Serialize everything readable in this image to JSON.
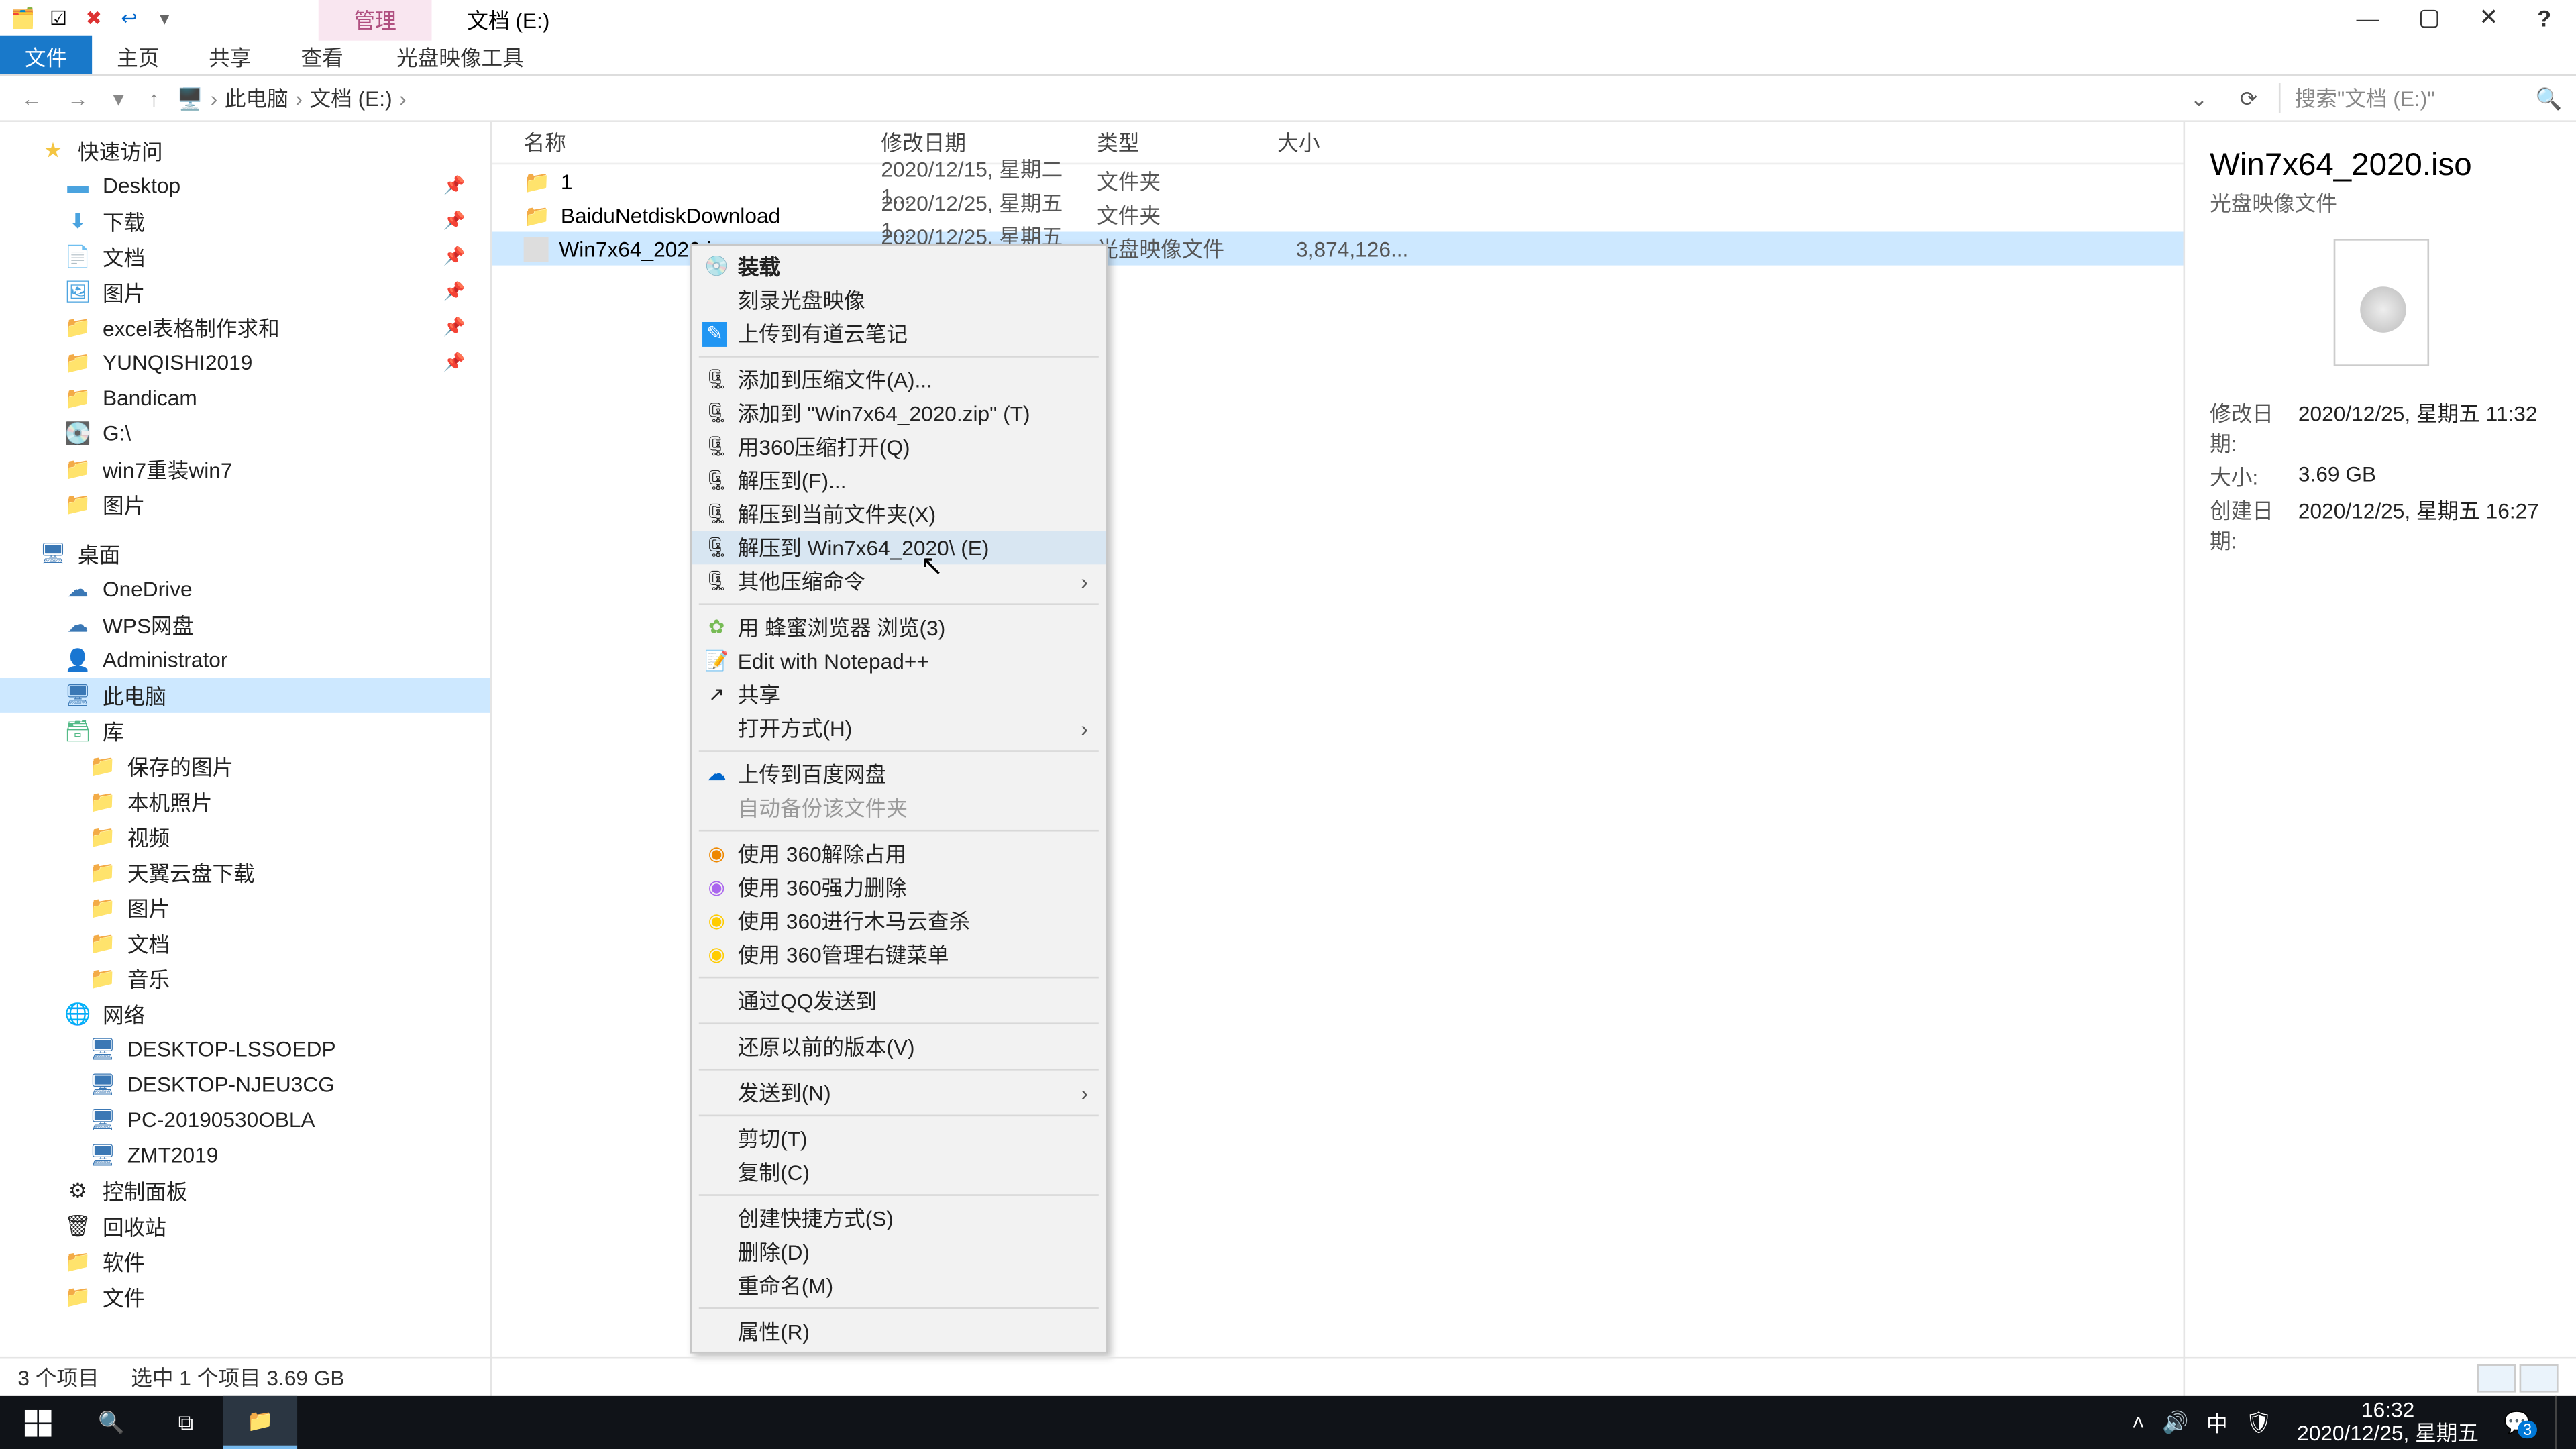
{
  "window": {
    "title_tab_manage": "管理",
    "title_tab_location": "文档 (E:)"
  },
  "ribbon": {
    "file": "文件",
    "home": "主页",
    "share": "共享",
    "view": "查看",
    "iso_tools": "光盘映像工具"
  },
  "address": {
    "root": "此电脑",
    "folder": "文档 (E:)",
    "search_placeholder": "搜索\"文档 (E:)\""
  },
  "tree": {
    "quick": "快速访问",
    "desktop": "Desktop",
    "downloads": "下载",
    "documents": "文档",
    "pictures": "图片",
    "excel": "excel表格制作求和",
    "yunqishi": "YUNQISHI2019",
    "bandicam": "Bandicam",
    "g_drive": "G:\\",
    "win7": "win7重装win7",
    "pictures2": "图片",
    "desk": "桌面",
    "onedrive": "OneDrive",
    "wps": "WPS网盘",
    "admin": "Administrator",
    "thispc": "此电脑",
    "library": "库",
    "saved_pics": "保存的图片",
    "camera_roll": "本机照片",
    "videos": "视频",
    "tianyi": "天翼云盘下载",
    "pics3": "图片",
    "docs3": "文档",
    "music": "音乐",
    "network": "网络",
    "desktop_lss": "DESKTOP-LSSOEDP",
    "desktop_nje": "DESKTOP-NJEU3CG",
    "pc_2019": "PC-20190530OBLA",
    "zmt": "ZMT2019",
    "control": "控制面板",
    "recycle": "回收站",
    "software": "软件",
    "files": "文件"
  },
  "columns": {
    "name": "名称",
    "date": "修改日期",
    "type": "类型",
    "size": "大小"
  },
  "rows": [
    {
      "name": "1",
      "date": "2020/12/15, 星期二 1...",
      "type": "文件夹",
      "size": ""
    },
    {
      "name": "BaiduNetdiskDownload",
      "date": "2020/12/25, 星期五 1...",
      "type": "文件夹",
      "size": ""
    },
    {
      "name": "Win7x64_2020.iso",
      "date": "2020/12/25, 星期五 1...",
      "type": "光盘映像文件",
      "size": "3,874,126..."
    }
  ],
  "ctx": {
    "mount": "装载",
    "burn": "刻录光盘映像",
    "upload_youdao": "上传到有道云笔记",
    "add_archive": "添加到压缩文件(A)...",
    "add_zip": "添加到 \"Win7x64_2020.zip\" (T)",
    "open_360zip": "用360压缩打开(Q)",
    "extract_to": "解压到(F)...",
    "extract_here": "解压到当前文件夹(X)",
    "extract_named": "解压到 Win7x64_2020\\ (E)",
    "other_zip": "其他压缩命令",
    "browse_bee": "用 蜂蜜浏览器 浏览(3)",
    "notepad": "Edit with Notepad++",
    "share": "共享",
    "open_with": "打开方式(H)",
    "upload_baidu": "上传到百度网盘",
    "auto_backup": "自动备份该文件夹",
    "unlock360": "使用 360解除占用",
    "force_del360": "使用 360强力删除",
    "trojan360": "使用 360进行木马云查杀",
    "manage360": "使用 360管理右键菜单",
    "send_qq": "通过QQ发送到",
    "restore_prev": "还原以前的版本(V)",
    "send_to": "发送到(N)",
    "cut": "剪切(T)",
    "copy": "复制(C)",
    "shortcut": "创建快捷方式(S)",
    "delete": "删除(D)",
    "rename": "重命名(M)",
    "properties": "属性(R)"
  },
  "details": {
    "title": "Win7x64_2020.iso",
    "subtitle": "光盘映像文件",
    "mod_label": "修改日期:",
    "mod_value": "2020/12/25, 星期五 11:32",
    "size_label": "大小:",
    "size_value": "3.69 GB",
    "created_label": "创建日期:",
    "created_value": "2020/12/25, 星期五 16:27"
  },
  "status": {
    "count": "3 个项目",
    "selection": "选中 1 个项目  3.69 GB"
  },
  "taskbar": {
    "time": "16:32",
    "date": "2020/12/25, 星期五",
    "ime": "中",
    "notif_count": "3"
  }
}
